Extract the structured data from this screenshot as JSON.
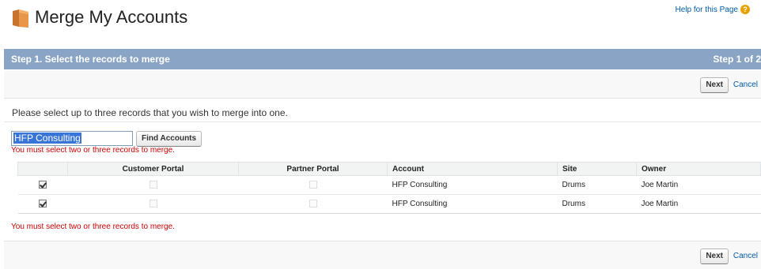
{
  "header": {
    "title": "Merge My Accounts",
    "help_link": "Help for this Page",
    "help_icon": "question-icon"
  },
  "step": {
    "title": "Step 1. Select the records to merge",
    "count": "Step 1 of 2"
  },
  "buttons": {
    "next": "Next",
    "cancel": "Cancel",
    "find_accounts": "Find Accounts"
  },
  "instructions": "Please select up to three records that you wish to merge into one.",
  "search": {
    "value": "HFP Consulting"
  },
  "error_message": "You must select two or three records to merge.",
  "table": {
    "columns": [
      "",
      "Customer Portal",
      "Partner Portal",
      "Account",
      "Site",
      "Owner"
    ],
    "rows": [
      {
        "selected": true,
        "customer_portal": false,
        "partner_portal": false,
        "account": "HFP Consulting",
        "site": "Drums",
        "owner": "Joe Martin"
      },
      {
        "selected": true,
        "customer_portal": false,
        "partner_portal": false,
        "account": "HFP Consulting",
        "site": "Drums",
        "owner": "Joe Martin"
      }
    ]
  },
  "colors": {
    "step_bar": "#8aa4c5",
    "link": "#015ba7",
    "error": "#cc0000",
    "selection": "#3875d7"
  }
}
